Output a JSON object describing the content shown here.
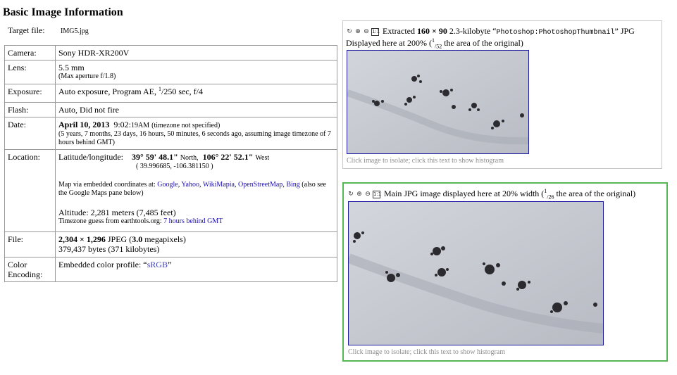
{
  "section_title": "Basic Image Information",
  "target": {
    "label": "Target file:",
    "value": "IMG5.jpg"
  },
  "rows": {
    "camera": {
      "label": "Camera:",
      "value": "Sony HDR-XR200V"
    },
    "lens": {
      "label": "Lens:",
      "value": "5.5 mm",
      "note": "(Max aperture f/1.8)"
    },
    "exposure": {
      "label": "Exposure:",
      "value_pre": "Auto exposure, Program AE, ",
      "frac_num": "1",
      "frac_den": "/250",
      "value_post": " sec, f/4"
    },
    "flash": {
      "label": "Flash:",
      "value": "Auto, Did not fire"
    },
    "date": {
      "label": "Date:",
      "date": "April 10, 2013",
      "time": "9:02:",
      "time_small": "19AM",
      "tz_note": "(timezone not specified)",
      "ago": "(5 years, 7 months, 23 days, 16 hours, 50 minutes, 6 seconds ago, assuming image timezone of 7 hours behind GMT)"
    },
    "location": {
      "label": "Location:",
      "latlong_label": "Latitude/longitude:",
      "lat": "39° 59' 48.1\"",
      "lat_dir": "North,",
      "lon": "106° 22' 52.1\"",
      "lon_dir": "West",
      "decimal": "( 39.996685, -106.381150 )",
      "map_text": "Map via embedded coordinates at:",
      "map_links": [
        "Google",
        "Yahoo",
        "WikiMapia",
        "OpenStreetMap",
        "Bing"
      ],
      "map_suffix": "(also see the Google Maps pane below)",
      "altitude": "Altitude: 2,281 meters (7,485 feet)",
      "tz_guess": "Timezone guess from earthtools.org:",
      "tz_link": "7 hours behind GMT"
    },
    "file": {
      "label": "File:",
      "dims": "2,304 × 1,296",
      "type": " JPEG (",
      "mp": "3.0",
      "mp_suffix": " megapixels)",
      "bytes": "379,437 bytes (371 kilobytes)"
    },
    "color": {
      "label": "Color Encoding:",
      "value": "Embedded color profile: “",
      "profile": "sRGB",
      "value_end": "”"
    }
  },
  "thumb_panel": {
    "cap_pre": "Extracted ",
    "cap_dims": "160 × 90",
    "cap_mid": " 2.3-kilobyte “",
    "cap_name": "Photoshop:PhotoshopThumbnail",
    "cap_post": "” JPG",
    "line2_pre": "Displayed here at 200% (",
    "frac_num": "1",
    "frac_den": "/52",
    "line2_post": " the area of the original)",
    "hint": "Click image to isolate; click this text to show histogram"
  },
  "main_panel": {
    "cap_pre": "Main JPG image displayed here at 20% width (",
    "frac_num": "1",
    "frac_den": "/26",
    "cap_post": " the area of the original)",
    "hint": "Click image to isolate; click this text to show histogram"
  },
  "icons": [
    "reload-icon",
    "zoom-in-icon",
    "zoom-out-icon",
    "actual-size-icon"
  ],
  "tool_label_1to1": "1:1",
  "colors": {
    "link": "#1a0dab",
    "panel_border_active": "#55b855",
    "image_border": "#1c1c9c"
  }
}
